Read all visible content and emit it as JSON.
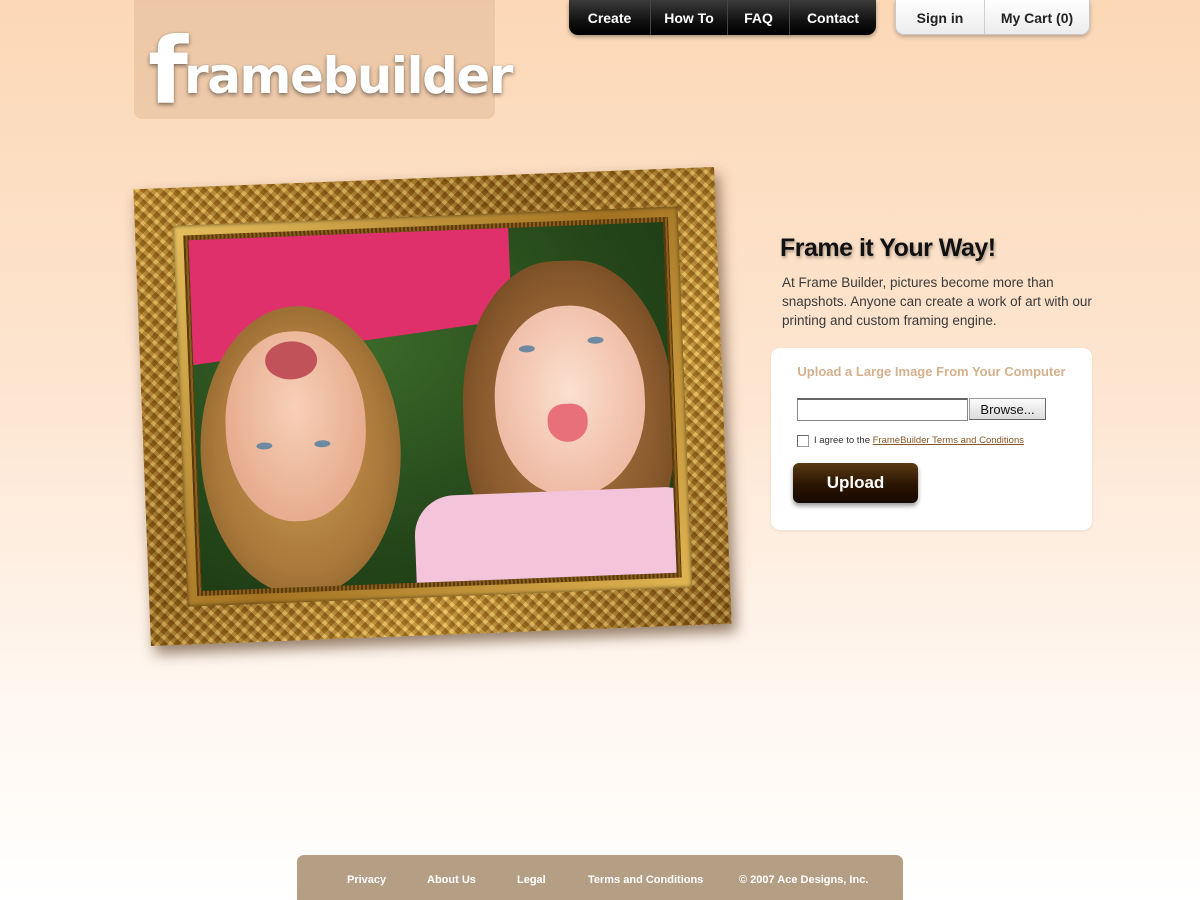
{
  "logo": {
    "first_letter": "f",
    "rest": "ramebuilder"
  },
  "nav": {
    "main": [
      "Create",
      "How To",
      "FAQ",
      "Contact"
    ],
    "user": [
      "Sign in",
      "My Cart (0)"
    ]
  },
  "hero": {
    "headline": "Frame it Your Way!",
    "intro": "At Frame Builder, pictures become more than snapshots. Anyone can create a work of art with our printing and custom framing engine."
  },
  "upload": {
    "title": "Upload a Large Image From Your Computer",
    "file_value": "",
    "browse_label": "Browse...",
    "agree_prefix": "I agree to the ",
    "agree_link": "FrameBuilder Terms and Conditions",
    "agree_checked": false,
    "button_label": "Upload"
  },
  "footer": {
    "links": [
      "Privacy",
      "About Us",
      "Legal",
      "Terms and Conditions"
    ],
    "copyright": "© 2007 Ace Designs, Inc."
  },
  "colors": {
    "accent_brown": "#2a1503",
    "footer_bg": "#b59f84",
    "upload_title": "#d4b08c",
    "link": "#8a5526"
  },
  "icons": [
    "checkbox-icon"
  ]
}
